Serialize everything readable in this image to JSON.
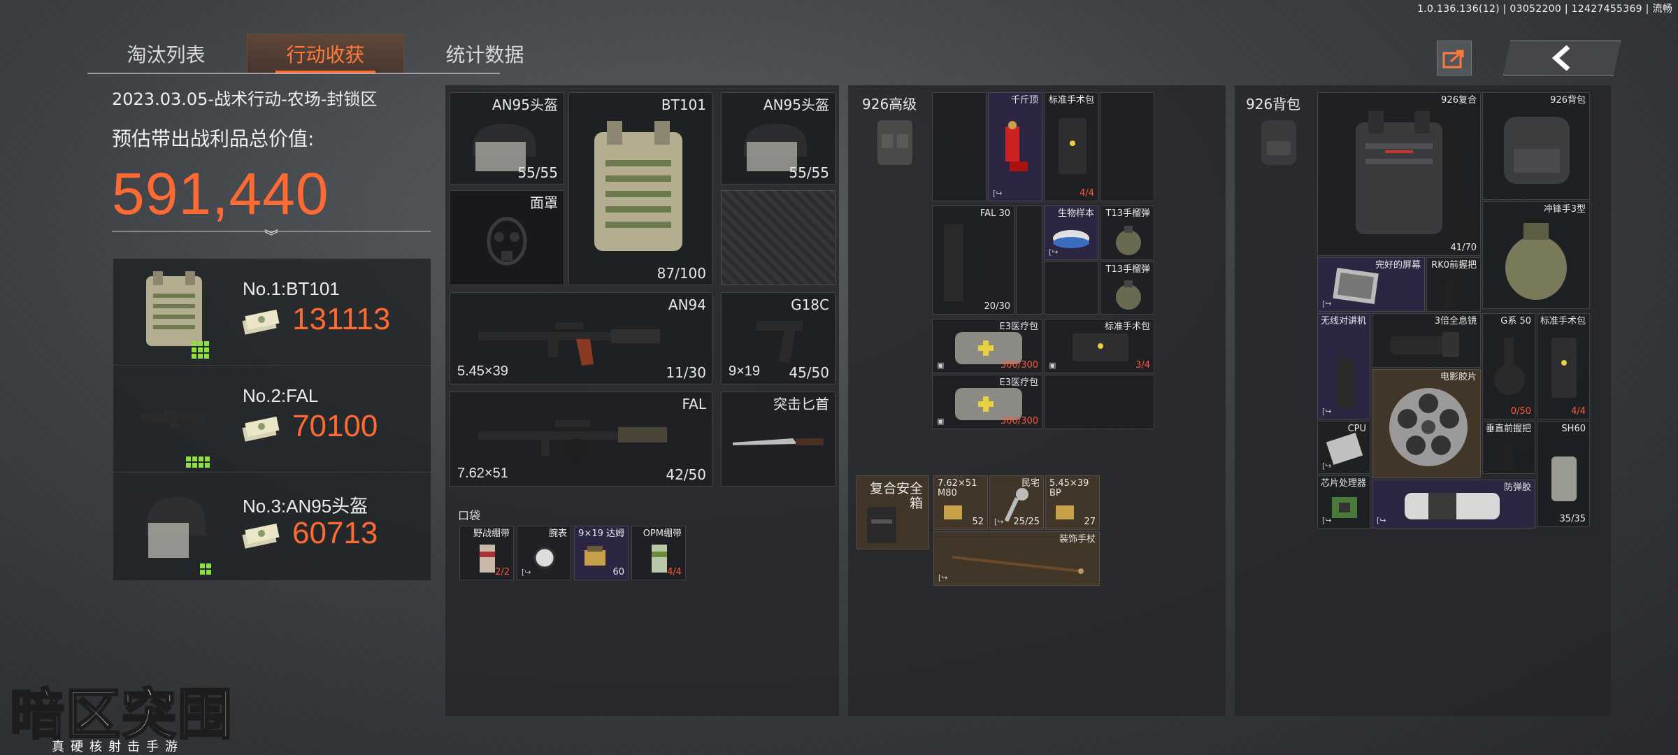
{
  "version": "1.0.136.136(12) | 03052200 | 12427455369 | 流畅",
  "tabs": [
    {
      "label": "淘汰列表",
      "active": false
    },
    {
      "label": "行动收获",
      "active": true
    },
    {
      "label": "统计数据",
      "active": false
    }
  ],
  "summary": {
    "operation": "2023.03.05-战术行动-农场-封锁区",
    "value_label": "预估带出战利品总价值:",
    "total_value": "591,440"
  },
  "top_items": [
    {
      "name": "No.1:BT101",
      "value": "131113"
    },
    {
      "name": "No.2:FAL",
      "value": "70100"
    },
    {
      "name": "No.3:AN95头盔",
      "value": "60713"
    }
  ],
  "loadout": {
    "helmet_left": {
      "label": "AN95头盔",
      "count": "55/55"
    },
    "armor": {
      "label": "BT101",
      "count": "87/100"
    },
    "helmet_right": {
      "label": "AN95头盔",
      "count": "55/55"
    },
    "mask": {
      "label": "面罩"
    },
    "primary1": {
      "label": "AN94",
      "caliber": "5.45×39",
      "ammo": "11/30"
    },
    "sidearm": {
      "label": "G18C",
      "caliber": "9×19",
      "ammo": "45/50"
    },
    "primary2": {
      "label": "FAL",
      "caliber": "7.62×51",
      "ammo": "42/50"
    },
    "melee": {
      "label": "突击匕首"
    },
    "pocket_label": "口袋",
    "pockets": [
      {
        "label": "野战绷带",
        "count": "2/2"
      },
      {
        "label": "腕表",
        "count": ""
      },
      {
        "label": "9×19 达姆",
        "count": "60"
      },
      {
        "label": "OPM绷带",
        "count": "4/4"
      }
    ]
  },
  "rig": {
    "title": "926高级",
    "items": {
      "thousand_top": {
        "label": "千斤顶"
      },
      "surgery_kit_a": {
        "label": "标准手术包",
        "count": "4/4"
      },
      "fal_mag": {
        "label": "FAL 30",
        "count": "20/30"
      },
      "bio_sample": {
        "label": "生物样本"
      },
      "grenade_a": {
        "label": "T13手榴弹"
      },
      "grenade_b": {
        "label": "T13手榴弹"
      },
      "med_kit_a": {
        "label": "E3医疗包",
        "count": "300/300"
      },
      "surgery_kit_b": {
        "label": "标准手术包",
        "count": "3/4"
      },
      "med_kit_b": {
        "label": "E3医疗包",
        "count": "300/300"
      }
    },
    "secure": {
      "title": "复合安全箱",
      "ammo_a": {
        "label": "7.62×51 M80",
        "count": "52"
      },
      "key": {
        "label": "民宅",
        "count": "25/25"
      },
      "ammo_b": {
        "label": "5.45×39 BP",
        "count": "27"
      },
      "cane": {
        "label": "装饰手杖"
      }
    }
  },
  "backpack": {
    "title": "926背包",
    "items": {
      "armor": {
        "label": "926复合",
        "count": "41/70"
      },
      "bag": {
        "label": "926背包"
      },
      "pouch": {
        "label": "冲锋手3型"
      },
      "screen": {
        "label": "完好的屏幕"
      },
      "grip_rk0": {
        "label": "RK0前握把"
      },
      "radio": {
        "label": "无线对讲机"
      },
      "scope": {
        "label": "3倍全息镜"
      },
      "g_mag": {
        "label": "G系 50",
        "count": "0/50"
      },
      "surgery_kit": {
        "label": "标准手术包",
        "count": "4/4"
      },
      "film": {
        "label": "电影胶片"
      },
      "cpu": {
        "label": "CPU"
      },
      "vgrip": {
        "label": "垂直前握把"
      },
      "sh60": {
        "label": "SH60",
        "count": "35/35"
      },
      "chip": {
        "label": "芯片处理器"
      },
      "glue": {
        "label": "防弹胶"
      }
    }
  },
  "logo": {
    "title": "暗区突围",
    "subtitle": "真硬核射击手游"
  },
  "colors": {
    "accent": "#ff6a33",
    "legendary": "#3b2f5e",
    "epic_brown": "#4a3a28"
  }
}
